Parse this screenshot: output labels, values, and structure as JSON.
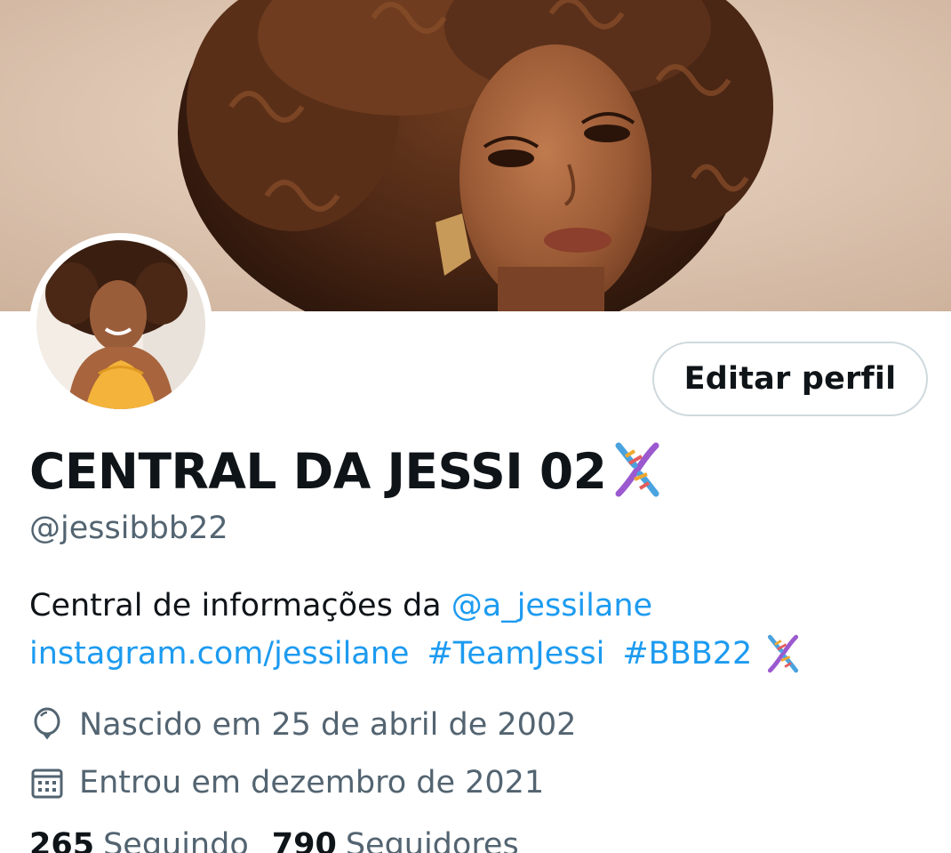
{
  "profile": {
    "display_name": "CENTRAL DA JESSI 02",
    "handle": "@jessibbb22",
    "edit_button_label": "Editar perfil",
    "bio": {
      "text": "Central de informações da ",
      "mention": "@a_jessilane",
      "link": "instagram.com/jessilane",
      "hashtag_1": "#TeamJessi",
      "hashtag_2": "#BBB22"
    },
    "born": "Nascido em 25 de abril de 2002",
    "joined": "Entrou em dezembro de 2021",
    "stats": {
      "following_count": "265",
      "following_label": "Seguindo",
      "followers_count": "790",
      "followers_label": "Seguidores"
    }
  },
  "icons": {
    "name_emoji": "dna-emoji",
    "bio_emoji": "dna-emoji",
    "born_icon": "balloon-icon",
    "joined_icon": "calendar-icon"
  },
  "colors": {
    "link": "#1d9bf0",
    "secondary_text": "#536471",
    "primary_text": "#0f1419",
    "button_border": "#cfd9de"
  }
}
